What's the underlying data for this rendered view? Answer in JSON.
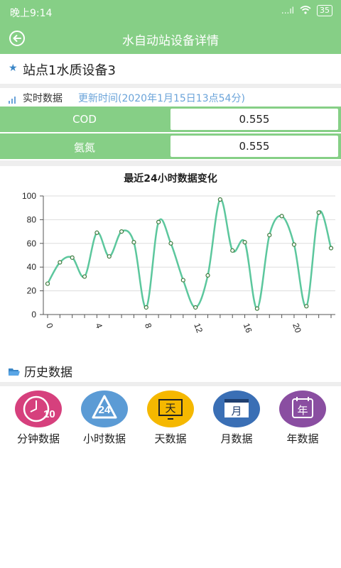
{
  "status": {
    "time": "晚上9:14",
    "signal": "...ıl",
    "battery": "35"
  },
  "appbar": {
    "title": "水自动站设备详情"
  },
  "device": {
    "name": "站点1水质设备3"
  },
  "realtime": {
    "label": "实时数据",
    "update_time": "更新时间(2020年1月15日13点54分)"
  },
  "readings": [
    {
      "name": "COD",
      "value": "0.555"
    },
    {
      "name": "氨氮",
      "value": "0.555"
    }
  ],
  "chart_data": {
    "type": "line",
    "title": "最近24小时数据变化",
    "x": [
      0,
      1,
      2,
      3,
      4,
      5,
      6,
      7,
      8,
      9,
      10,
      11,
      12,
      13,
      14,
      15,
      16,
      17,
      18,
      19,
      20,
      21,
      22,
      23
    ],
    "series": [
      {
        "values": [
          26,
          44,
          48,
          32,
          69,
          49,
          70,
          61,
          6,
          78,
          60,
          29,
          6,
          33,
          97,
          54,
          61,
          5,
          67,
          83,
          59,
          7,
          86,
          56
        ]
      }
    ],
    "xticks": [
      "0",
      "4",
      "8",
      "12",
      "16",
      "20"
    ],
    "yticks": [
      "0",
      "20",
      "40",
      "60",
      "80",
      "100"
    ],
    "ylim": [
      0,
      100
    ],
    "xlim": [
      0,
      23
    ],
    "line_color": "#5cc79d",
    "grid": true
  },
  "history": {
    "label": "历史数据",
    "buttons": [
      {
        "label": "分钟数据",
        "glyph": "10",
        "color": "#d6407d"
      },
      {
        "label": "小时数据",
        "glyph": "24",
        "color": "#5b9bd5"
      },
      {
        "label": "天数据",
        "glyph": "天",
        "color": "#f5b800"
      },
      {
        "label": "月数据",
        "glyph": "月",
        "color": "#3a6fb5"
      },
      {
        "label": "年数据",
        "glyph": "年",
        "color": "#8a4ea1"
      }
    ]
  }
}
